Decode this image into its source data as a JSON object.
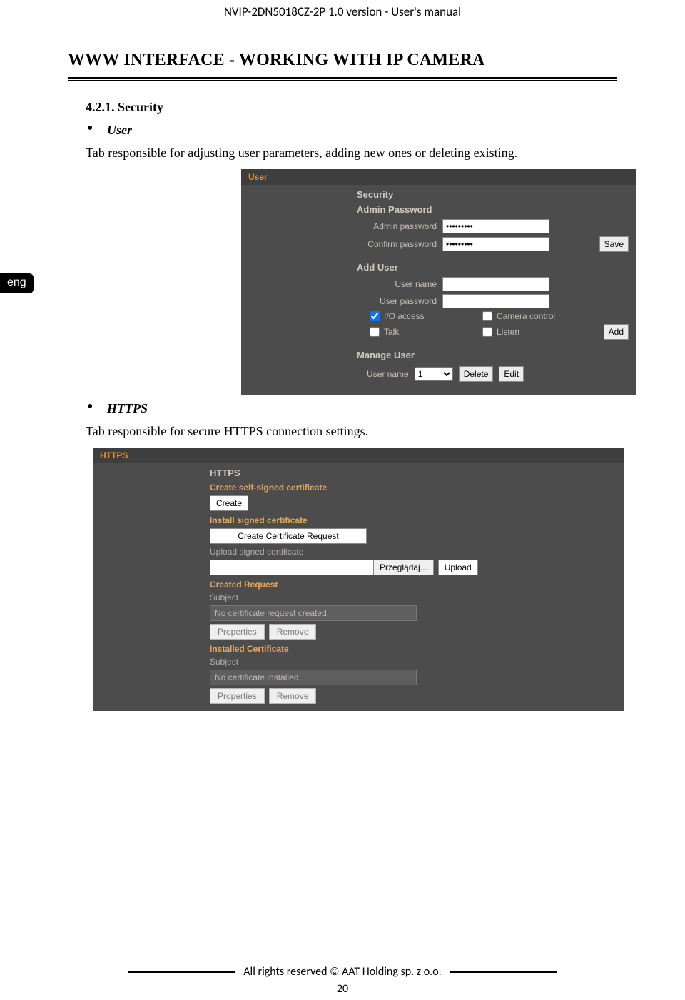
{
  "doc": {
    "header": "NVIP-2DN5018CZ-2P 1.0 version - User's manual",
    "page_title": "WWW INTERFACE - WORKING WITH IP CAMERA",
    "section_number": "4.2.1. Security",
    "bullet_user": "User",
    "para_user": "Tab responsible for adjusting user parameters, adding new ones or deleting existing.",
    "bullet_https": "HTTPS",
    "para_https": "Tab responsible for secure HTTPS connection settings.",
    "footer": "All rights reserved © AAT Holding sp. z o.o.",
    "page_number": "20",
    "lang": "eng"
  },
  "user_panel": {
    "tab": "User",
    "heading_security": "Security",
    "heading_admin_pw": "Admin Password",
    "admin_pw_label": "Admin password",
    "admin_pw_value": "•••••••••",
    "confirm_pw_label": "Confirm password",
    "confirm_pw_value": "•••••••••",
    "save": "Save",
    "heading_add_user": "Add User",
    "user_name_label": "User name",
    "user_pw_label": "User password",
    "cb_io": "I/O access",
    "cb_camctrl": "Camera control",
    "cb_talk": "Talk",
    "cb_listen": "Listen",
    "add": "Add",
    "heading_manage": "Manage User",
    "manage_user_name": "User name",
    "manage_select_value": "1",
    "delete": "Delete",
    "edit": "Edit"
  },
  "https_panel": {
    "tab": "HTTPS",
    "heading": "HTTPS",
    "create_self": "Create self-signed certificate",
    "create": "Create",
    "install_signed": "Install signed certificate",
    "create_cert_req": "Create Certificate Request",
    "upload_signed": "Upload signed certificate",
    "browse": "Przeglądaj...",
    "upload": "Upload",
    "created_request": "Created Request",
    "subject": "Subject",
    "no_request": "No certificate request created.",
    "properties": "Properties",
    "remove": "Remove",
    "installed_cert": "Installed Certificate",
    "no_installed": "No certificate installed."
  }
}
